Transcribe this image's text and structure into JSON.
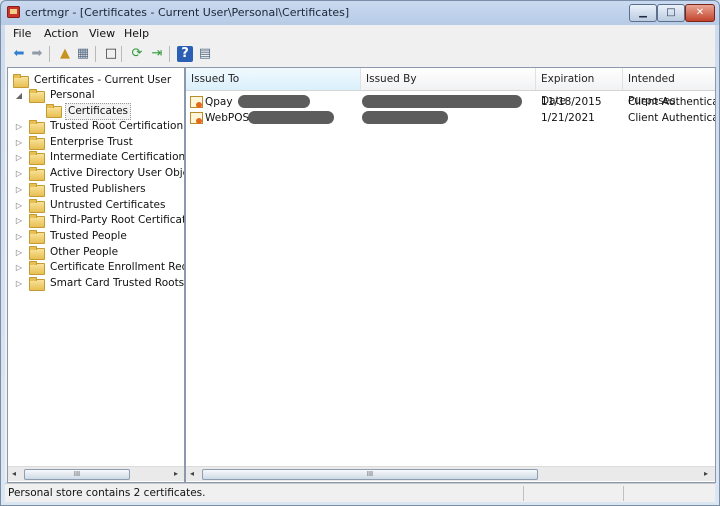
{
  "window": {
    "title": "certmgr - [Certificates - Current User\\Personal\\Certificates]",
    "minimize_glyph": "▁",
    "maximize_glyph": "□",
    "close_glyph": "✕"
  },
  "menu": [
    {
      "label": "File"
    },
    {
      "label": "Action"
    },
    {
      "label": "View"
    },
    {
      "label": "Help"
    }
  ],
  "toolbar": [
    {
      "name": "back-icon",
      "glyph": "⬅",
      "color": "#2f7fd1"
    },
    {
      "name": "forward-icon",
      "glyph": "➡",
      "color": "#8f9aa6"
    },
    {
      "name": "up-folder-icon",
      "glyph": "▲",
      "color": "#c7931f"
    },
    {
      "name": "show-hide-tree-icon",
      "glyph": "▦",
      "color": "#566b86"
    },
    {
      "name": "properties-icon",
      "glyph": "□",
      "color": "#333333"
    },
    {
      "name": "refresh-icon",
      "glyph": "⟳",
      "color": "#2f9a3a"
    },
    {
      "name": "export-list-icon",
      "glyph": "⇥",
      "color": "#2f9a3a"
    },
    {
      "name": "help-icon",
      "glyph": "?",
      "color": "#ffffff"
    },
    {
      "name": "details-pane-icon",
      "glyph": "▤",
      "color": "#566b86"
    }
  ],
  "tree": {
    "root": "Certificates - Current User",
    "personal": "Personal",
    "personal_child": "Certificates",
    "stores": [
      "Trusted Root Certification Au",
      "Enterprise Trust",
      "Intermediate Certification Au",
      "Active Directory User Object",
      "Trusted Publishers",
      "Untrusted Certificates",
      "Third-Party Root Certification",
      "Trusted People",
      "Other People",
      "Certificate Enrollment Reque:",
      "Smart Card Trusted Roots"
    ]
  },
  "columns": [
    "Issued To",
    "Issued By",
    "Expiration Date",
    "Intended Purposes"
  ],
  "rows": [
    {
      "issued_to": "Qpay",
      "issued_by": "",
      "expiration": "11/18/2015",
      "purposes": "Client Authenticati..."
    },
    {
      "issued_to": "WebPOS",
      "issued_by": "",
      "expiration": "1/21/2021",
      "purposes": "Client Authenticati..."
    }
  ],
  "scroll": {
    "left_arrow": "◂",
    "right_arrow": "▸",
    "grip": "III"
  },
  "status": "Personal store contains 2 certificates."
}
